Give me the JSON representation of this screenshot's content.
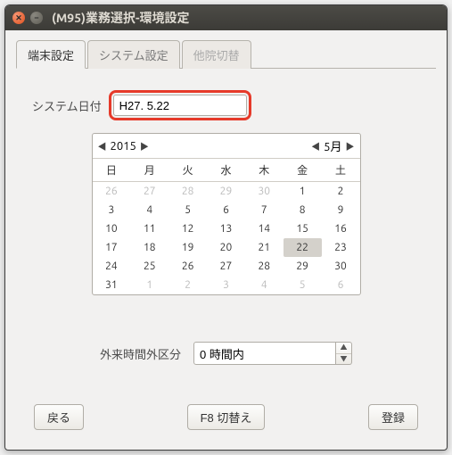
{
  "window": {
    "title": "(M95)業務選択-環境設定"
  },
  "tabs": [
    {
      "label": "端末設定",
      "active": true
    },
    {
      "label": "システム設定",
      "active": false
    },
    {
      "label": "他院切替",
      "active": false,
      "disabled": true
    }
  ],
  "system_date": {
    "label": "システム日付",
    "value": "H27. 5.22"
  },
  "calendar": {
    "year": "2015",
    "month": "5月",
    "dow": [
      "日",
      "月",
      "火",
      "水",
      "木",
      "金",
      "土"
    ],
    "weeks": [
      [
        {
          "d": "26",
          "o": true
        },
        {
          "d": "27",
          "o": true
        },
        {
          "d": "28",
          "o": true
        },
        {
          "d": "29",
          "o": true
        },
        {
          "d": "30",
          "o": true
        },
        {
          "d": "1"
        },
        {
          "d": "2"
        }
      ],
      [
        {
          "d": "3"
        },
        {
          "d": "4"
        },
        {
          "d": "5"
        },
        {
          "d": "6"
        },
        {
          "d": "7"
        },
        {
          "d": "8"
        },
        {
          "d": "9"
        }
      ],
      [
        {
          "d": "10"
        },
        {
          "d": "11"
        },
        {
          "d": "12"
        },
        {
          "d": "13"
        },
        {
          "d": "14"
        },
        {
          "d": "15"
        },
        {
          "d": "16"
        }
      ],
      [
        {
          "d": "17"
        },
        {
          "d": "18"
        },
        {
          "d": "19"
        },
        {
          "d": "20"
        },
        {
          "d": "21"
        },
        {
          "d": "22",
          "sel": true
        },
        {
          "d": "23"
        }
      ],
      [
        {
          "d": "24"
        },
        {
          "d": "25"
        },
        {
          "d": "26"
        },
        {
          "d": "27"
        },
        {
          "d": "28"
        },
        {
          "d": "29"
        },
        {
          "d": "30"
        }
      ],
      [
        {
          "d": "31"
        },
        {
          "d": "1",
          "o": true
        },
        {
          "d": "2",
          "o": true
        },
        {
          "d": "3",
          "o": true
        },
        {
          "d": "4",
          "o": true
        },
        {
          "d": "5",
          "o": true
        },
        {
          "d": "6",
          "o": true
        }
      ]
    ]
  },
  "after_hours": {
    "label": "外来時間外区分",
    "value": "0 時間内"
  },
  "footer": {
    "back": "戻る",
    "switch": "F8 切替え",
    "register": "登録"
  }
}
